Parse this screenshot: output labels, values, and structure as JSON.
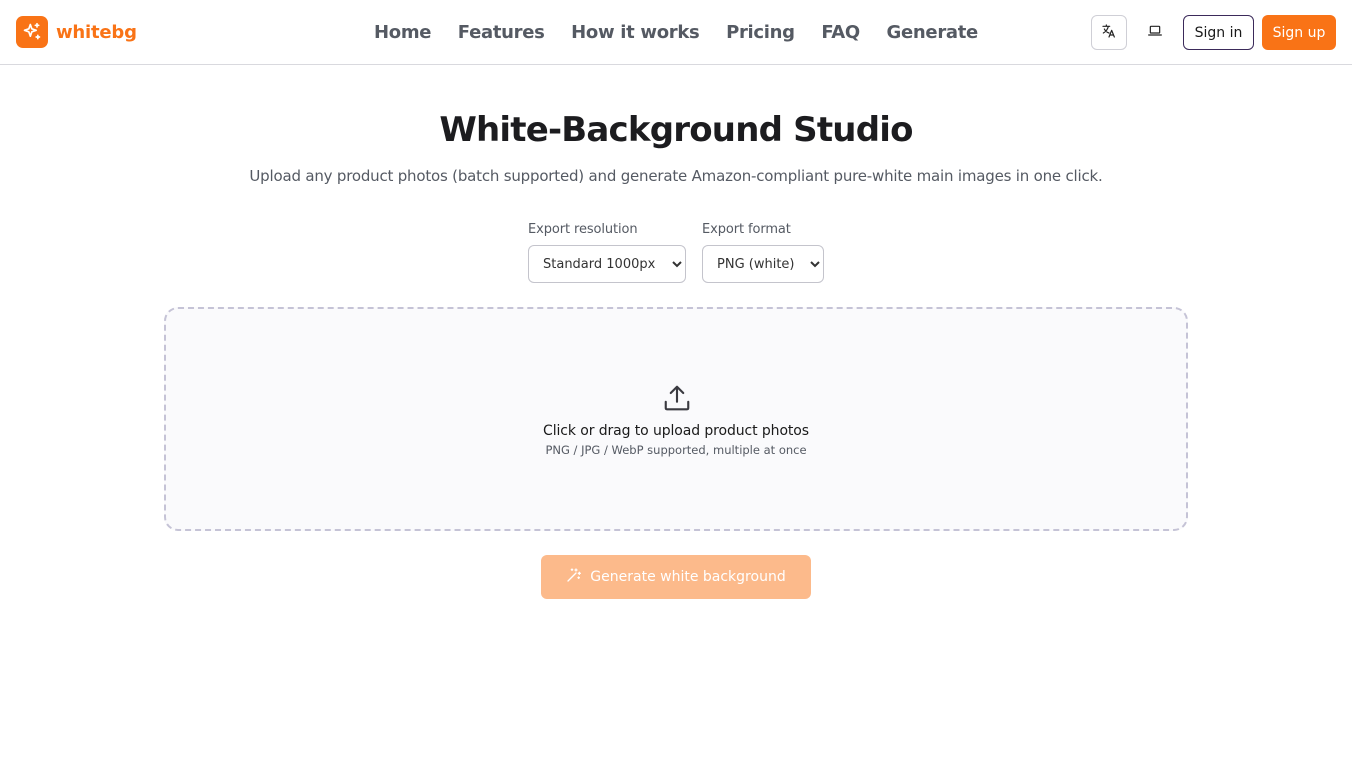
{
  "brand": {
    "name": "whitebg",
    "icon": "sparkles-icon",
    "color": "#f97316"
  },
  "nav": [
    {
      "label": "Home"
    },
    {
      "label": "Features"
    },
    {
      "label": "How it works"
    },
    {
      "label": "Pricing"
    },
    {
      "label": "FAQ"
    },
    {
      "label": "Generate"
    }
  ],
  "header_actions": {
    "language_icon": "translate-icon",
    "theme_icon": "laptop-icon",
    "sign_in": "Sign in",
    "sign_up": "Sign up"
  },
  "main": {
    "title": "White-Background Studio",
    "subtitle": "Upload any product photos (batch supported) and generate Amazon-compliant pure-white main images in one click."
  },
  "settings": {
    "resolution": {
      "label": "Export resolution",
      "selected": "Standard 1000px"
    },
    "format": {
      "label": "Export format",
      "selected": "PNG (white)"
    }
  },
  "dropzone": {
    "icon": "upload-icon",
    "title": "Click or drag to upload product photos",
    "hint": "PNG / JPG / WebP supported, multiple at once"
  },
  "generate": {
    "label": "Generate white background",
    "icon": "magic-wand-icon",
    "disabled": true
  },
  "colors": {
    "accent": "#f97316",
    "accent_disabled": "#fcba8b",
    "text_muted": "#555a63"
  }
}
